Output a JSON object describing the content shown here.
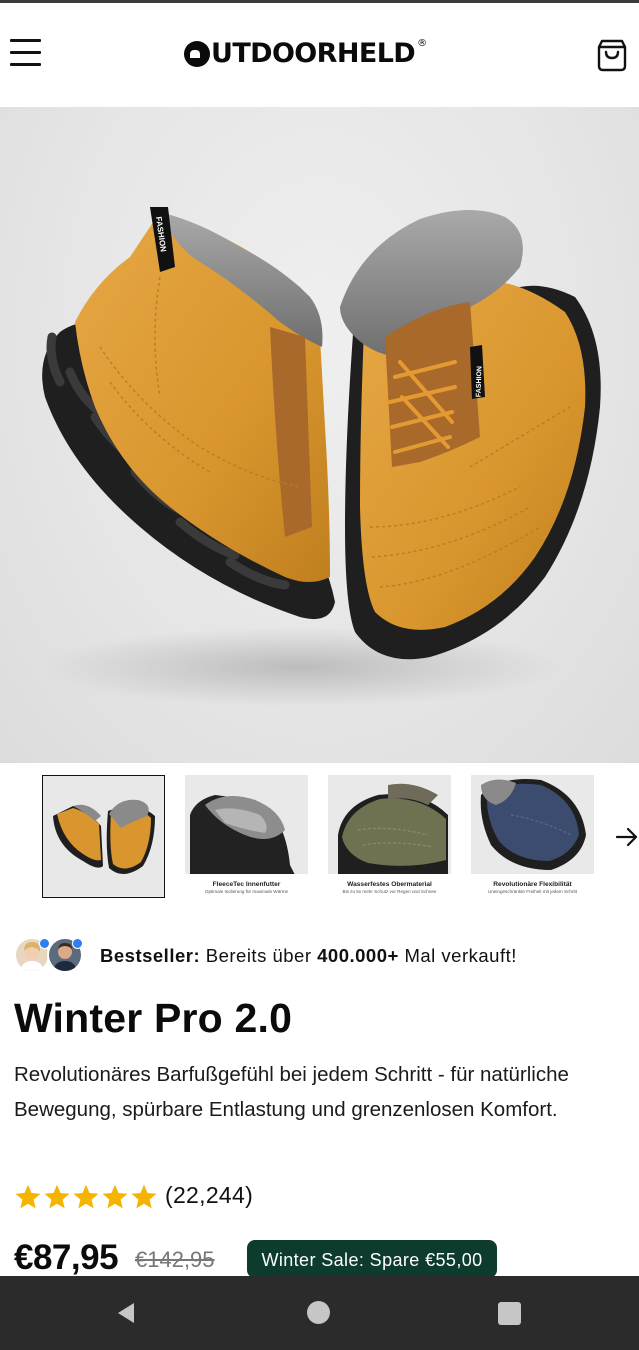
{
  "header": {
    "logo_text": "UTDOORHELD",
    "logo_registered": "®",
    "menu_icon": "hamburger-menu-icon",
    "cart_icon": "shopping-bag-icon"
  },
  "hero": {
    "left_boot_tag": "FASHION",
    "right_boot_tag": "FASHION"
  },
  "thumbnails": [
    {
      "caption": "",
      "subcaption": "",
      "active": true
    },
    {
      "caption": "FleeceTec Innenfutter",
      "subcaption": "Optimale Isolierung für maximale Wärme",
      "active": false
    },
    {
      "caption": "Wasserfestes Obermaterial",
      "subcaption": "Bis zu 5x mehr Schutz vor Regen und Schnee",
      "active": false
    },
    {
      "caption": "Revolutionäre Flexibilität",
      "subcaption": "Uneingeschränkte Freiheit mit jedem Schritt",
      "active": false
    }
  ],
  "bestseller": {
    "label": "Bestseller:",
    "text_before": " Bereits über ",
    "count": "400.000+",
    "text_after": " Mal verkauft!"
  },
  "product": {
    "title": "Winter Pro 2.0",
    "description": "Revolutionäres Barfußgefühl bei jedem Schritt - für natürliche Bewegung, spürbare Entlastung und grenzenlosen Komfort.",
    "rating": 5,
    "reviews": "(22,244)",
    "price": "€87,95",
    "old_price": "€142,95",
    "sale_badge": "Winter Sale: Spare €55,00"
  },
  "colors": {
    "boot_tan": "#d9962e",
    "sole": "#1f1f1f",
    "fur": "#8a8a8a",
    "sale_badge_bg": "#0d3b2e",
    "star": "#f5b400",
    "navbar": "#2b2b2b"
  },
  "navbar": {
    "back_icon": "back-triangle-icon",
    "home_icon": "home-circle-icon",
    "recents_icon": "recents-square-icon"
  }
}
